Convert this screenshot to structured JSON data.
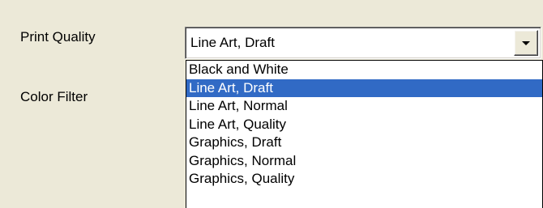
{
  "print_quality": {
    "label": "Print Quality",
    "selected_value": "Line Art, Draft",
    "options": [
      {
        "label": "Black and White",
        "selected": false
      },
      {
        "label": "Line Art, Draft",
        "selected": true
      },
      {
        "label": "Line Art, Normal",
        "selected": false
      },
      {
        "label": "Line Art, Quality",
        "selected": false
      },
      {
        "label": "Graphics, Draft",
        "selected": false
      },
      {
        "label": "Graphics, Normal",
        "selected": false
      },
      {
        "label": "Graphics, Quality",
        "selected": false
      }
    ],
    "dropdown_button_icon": "chevron-down-icon"
  },
  "color_filter": {
    "label": "Color Filter"
  },
  "colors": {
    "dialog_background": "#ece9d8",
    "selection_background": "#316ac5",
    "selection_text": "#ffffff"
  }
}
